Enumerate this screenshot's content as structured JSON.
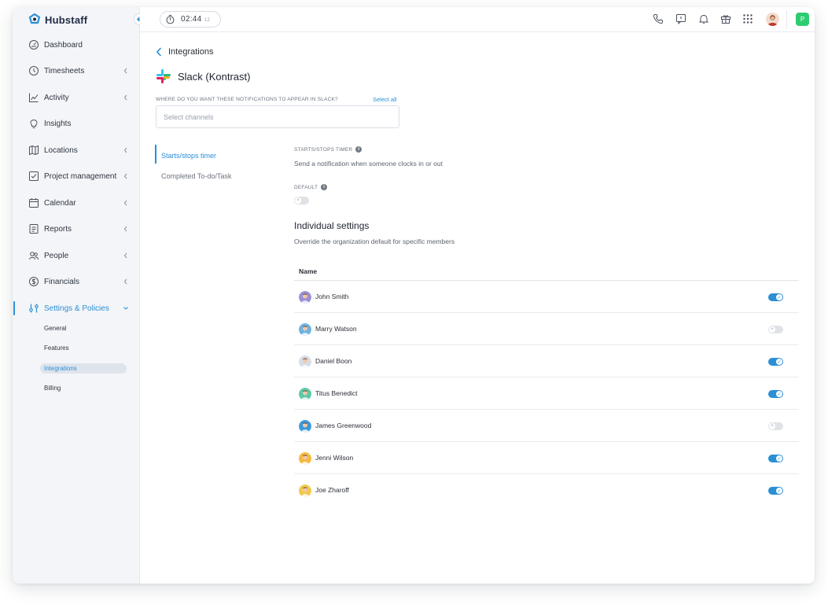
{
  "app": {
    "name": "Hubstaff"
  },
  "sidebar": {
    "items": [
      {
        "label": "Dashboard",
        "icon": "dashboard-icon",
        "chevron": false
      },
      {
        "label": "Timesheets",
        "icon": "clock-icon",
        "chevron": true
      },
      {
        "label": "Activity",
        "icon": "activity-chart-icon",
        "chevron": true
      },
      {
        "label": "Insights",
        "icon": "lightbulb-icon",
        "chevron": false
      },
      {
        "label": "Locations",
        "icon": "map-icon",
        "chevron": true
      },
      {
        "label": "Project management",
        "icon": "checkbox-icon",
        "chevron": true
      },
      {
        "label": "Calendar",
        "icon": "calendar-icon",
        "chevron": true
      },
      {
        "label": "Reports",
        "icon": "report-icon",
        "chevron": true
      },
      {
        "label": "People",
        "icon": "people-icon",
        "chevron": true
      },
      {
        "label": "Financials",
        "icon": "dollar-icon",
        "chevron": true
      },
      {
        "label": "Settings & Policies",
        "icon": "settings-sliders-icon",
        "chevron": true,
        "active": true
      }
    ],
    "sub_items": [
      "General",
      "Features",
      "Integrations",
      "Billing"
    ],
    "active_sub": "Integrations"
  },
  "topbar": {
    "timer": "02:44",
    "timer_seconds": "12",
    "user_badge": "P",
    "icons": [
      "phone-icon",
      "feedback-icon",
      "bell-icon",
      "gift-icon",
      "apps-grid-icon"
    ]
  },
  "main": {
    "back_label": "Integrations",
    "integration_title": "Slack (Kontrast)",
    "question": "WHERE DO YOU WANT THESE NOTIFICATIONS TO APPEAR IN SLACK?",
    "select_all": "Select all",
    "channels_placeholder": "Select channels",
    "subtabs": [
      "Starts/stops timer",
      "Completed To-do/Task"
    ],
    "section_caption": "STARTS/STOPS TIMER",
    "section_desc": "Send a notification when someone clocks in or out",
    "default_caption": "DEFAULT",
    "default_on": false,
    "individual_title": "Individual settings",
    "individual_desc": "Override the organization default for specific members",
    "table_header": "Name",
    "members": [
      {
        "name": "John Smith",
        "enabled": true,
        "avatar_color": "#9b8fd6"
      },
      {
        "name": "Marry Watson",
        "enabled": false,
        "avatar_color": "#6fb3e0"
      },
      {
        "name": "Daniel Boon",
        "enabled": true,
        "avatar_color": "#d7dde6"
      },
      {
        "name": "Titus Benedict",
        "enabled": true,
        "avatar_color": "#5cc9a7"
      },
      {
        "name": "James Greenwood",
        "enabled": false,
        "avatar_color": "#3d9ad9"
      },
      {
        "name": "Jenni Wilson",
        "enabled": true,
        "avatar_color": "#f5b942"
      },
      {
        "name": "Joe Zharoff",
        "enabled": true,
        "avatar_color": "#f2c94c"
      }
    ]
  },
  "colors": {
    "accent": "#2b8fd6",
    "sidebar_bg": "#f3f5f8",
    "badge": "#2ecc71"
  }
}
